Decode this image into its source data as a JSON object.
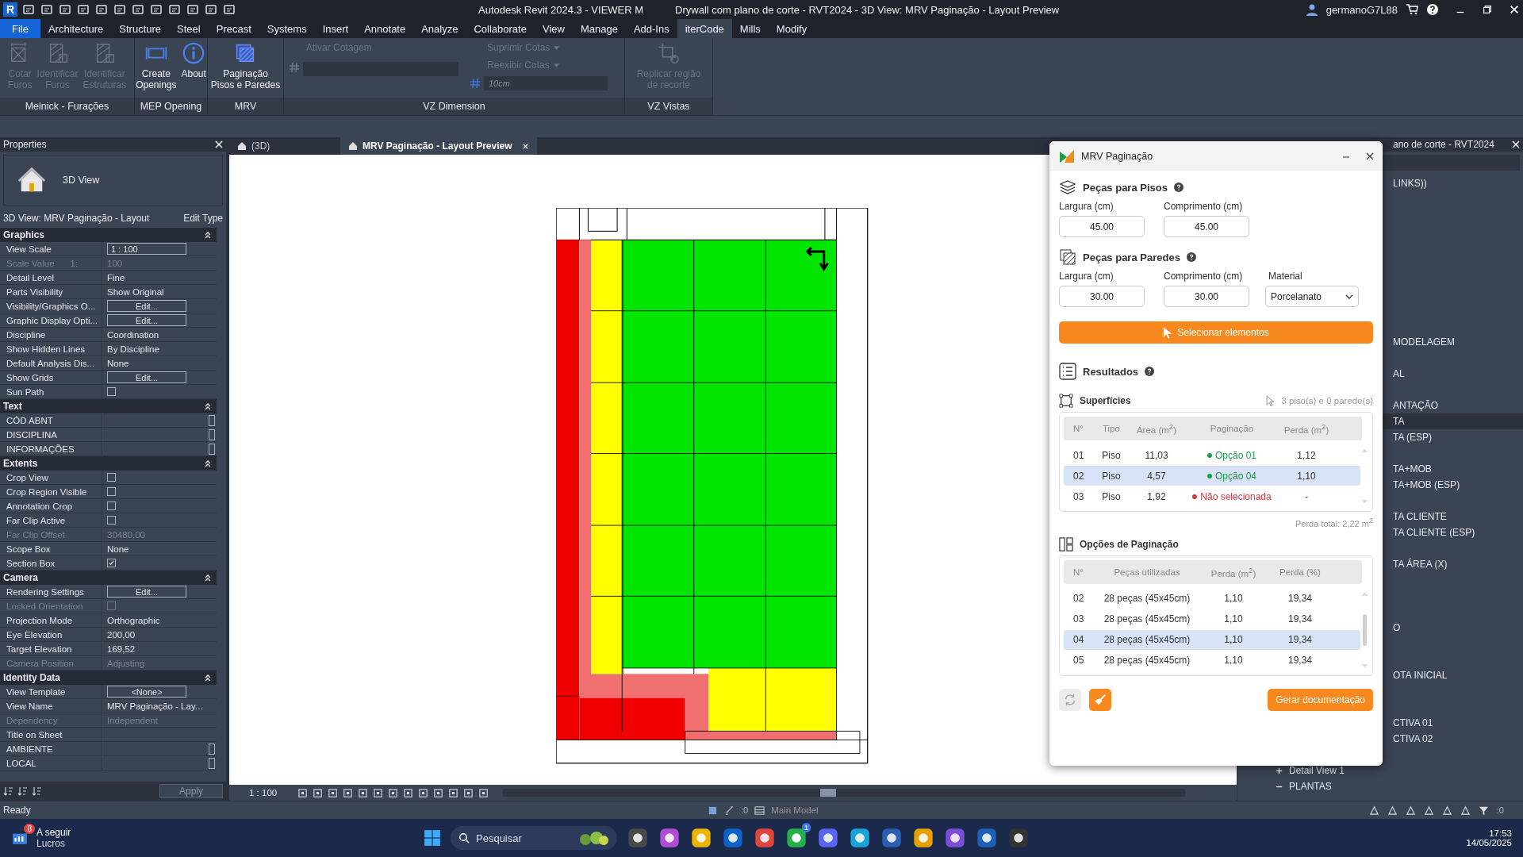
{
  "title_bar": {
    "app_logo": "R",
    "app_title": "Autodesk Revit 2024.3 - VIEWER M",
    "document_title": "Drywall com plano de corte - RVT2024 - 3D View: MRV Paginação - Layout Preview",
    "user": "germanoG7L88"
  },
  "menu_tabs": [
    {
      "label": "File",
      "kind": "file",
      "selected": false
    },
    {
      "label": "Architecture",
      "kind": "tab",
      "selected": false
    },
    {
      "label": "Structure",
      "kind": "tab",
      "selected": false
    },
    {
      "label": "Steel",
      "kind": "tab",
      "selected": false
    },
    {
      "label": "Precast",
      "kind": "tab",
      "selected": false
    },
    {
      "label": "Systems",
      "kind": "tab",
      "selected": false
    },
    {
      "label": "Insert",
      "kind": "tab",
      "selected": false
    },
    {
      "label": "Annotate",
      "kind": "tab",
      "selected": false
    },
    {
      "label": "Analyze",
      "kind": "tab",
      "selected": false
    },
    {
      "label": "Collaborate",
      "kind": "tab",
      "selected": false
    },
    {
      "label": "View",
      "kind": "tab",
      "selected": false
    },
    {
      "label": "Manage",
      "kind": "tab",
      "selected": false
    },
    {
      "label": "Add-Ins",
      "kind": "tab",
      "selected": false
    },
    {
      "label": "iterCode",
      "kind": "tab",
      "selected": true
    },
    {
      "label": "Mills",
      "kind": "tab",
      "selected": false
    },
    {
      "label": "Modify",
      "kind": "tab",
      "selected": false
    }
  ],
  "ribbon": {
    "panels": [
      {
        "title": "Melnick - Furações",
        "kind": "large",
        "buttons": [
          {
            "lines": [
              "Cotar",
              "Furos"
            ],
            "kind": "hole",
            "disabled": true
          },
          {
            "lines": [
              "Identificar",
              "Furos"
            ],
            "kind": "identify",
            "disabled": true
          },
          {
            "lines": [
              "Identificar",
              "Estruturas"
            ],
            "kind": "identify",
            "disabled": true
          }
        ]
      },
      {
        "title": "MEP Opening",
        "kind": "large",
        "buttons": [
          {
            "lines": [
              "Create",
              "Openings"
            ],
            "kind": "openings",
            "disabled": false
          },
          {
            "lines": [
              "About"
            ],
            "kind": "about",
            "disabled": false
          }
        ]
      },
      {
        "title": "MRV",
        "kind": "large",
        "buttons": [
          {
            "lines": [
              "Paginação",
              "Pisos e Paredes"
            ],
            "kind": "tiles",
            "disabled": false
          }
        ]
      },
      {
        "title": "VZ Dimension",
        "kind": "controls",
        "items": [
          {
            "label": "Ativar Cotagem",
            "disabled": true
          },
          {
            "label": "Suprimir Cotas",
            "disabled": true
          },
          {
            "label": "Reexibir Cotas",
            "disabled": true
          }
        ],
        "field_value": "10cm"
      },
      {
        "title": "VZ Vistas",
        "kind": "large",
        "buttons": [
          {
            "lines": [
              "Replicar região",
              "de recorte"
            ],
            "kind": "replicate",
            "disabled": true
          }
        ]
      }
    ]
  },
  "properties": {
    "title": "Properties",
    "type_name": "3D View",
    "instance": "3D View: MRV Paginação - Layout",
    "edit_type": "Edit Type",
    "apply": "Apply",
    "sections": [
      {
        "title": "Graphics",
        "rows": [
          {
            "label": "View Scale",
            "kind": "input",
            "value": "1 : 100",
            "disabled": false
          },
          {
            "label": "Scale Value",
            "suffix": "1:",
            "kind": "text",
            "value": "100",
            "disabled": true
          },
          {
            "label": "Detail Level",
            "kind": "text",
            "value": "Fine",
            "disabled": false
          },
          {
            "label": "Parts Visibility",
            "kind": "text",
            "value": "Show Original",
            "disabled": false
          },
          {
            "label": "Visibility/Graphics O...",
            "kind": "button",
            "value": "Edit...",
            "disabled": false
          },
          {
            "label": "Graphic Display Opti...",
            "kind": "button",
            "value": "Edit...",
            "disabled": false
          },
          {
            "label": "Discipline",
            "kind": "text",
            "value": "Coordination",
            "disabled": false
          },
          {
            "label": "Show Hidden Lines",
            "kind": "text",
            "value": "By Discipline",
            "disabled": false
          },
          {
            "label": "Default Analysis Dis...",
            "kind": "text",
            "value": "None",
            "disabled": false
          },
          {
            "label": "Show Grids",
            "kind": "button",
            "value": "Edit...",
            "disabled": false
          },
          {
            "label": "Sun Path",
            "kind": "checkbox",
            "checked": false,
            "disabled": false
          }
        ]
      },
      {
        "title": "Text",
        "rows": [
          {
            "label": "CÓD ABNT",
            "kind": "field",
            "disabled": false
          },
          {
            "label": "DISCIPLINA",
            "kind": "field",
            "disabled": false
          },
          {
            "label": "INFORMAÇÕES",
            "kind": "field",
            "disabled": false
          }
        ]
      },
      {
        "title": "Extents",
        "rows": [
          {
            "label": "Crop View",
            "kind": "checkbox",
            "checked": false,
            "disabled": false
          },
          {
            "label": "Crop Region Visible",
            "kind": "checkbox",
            "checked": false,
            "disabled": false
          },
          {
            "label": "Annotation Crop",
            "kind": "checkbox",
            "checked": false,
            "disabled": false
          },
          {
            "label": "Far Clip Active",
            "kind": "checkbox",
            "checked": false,
            "disabled": false
          },
          {
            "label": "Far Clip Offset",
            "kind": "text",
            "value": "30480,00",
            "disabled": true
          },
          {
            "label": "Scope Box",
            "kind": "text",
            "value": "None",
            "disabled": false
          },
          {
            "label": "Section Box",
            "kind": "checkbox",
            "checked": true,
            "disabled": false
          }
        ]
      },
      {
        "title": "Camera",
        "rows": [
          {
            "label": "Rendering Settings",
            "kind": "button",
            "value": "Edit...",
            "disabled": false
          },
          {
            "label": "Locked Orientation",
            "kind": "checkbox",
            "checked": false,
            "disabled": true
          },
          {
            "label": "Projection Mode",
            "kind": "text",
            "value": "Orthographic",
            "disabled": false
          },
          {
            "label": "Eye Elevation",
            "kind": "text",
            "value": "200,00",
            "disabled": false
          },
          {
            "label": "Target Elevation",
            "kind": "text",
            "value": "169,52",
            "disabled": false
          },
          {
            "label": "Camera Position",
            "kind": "text",
            "value": "Adjusting",
            "disabled": true
          }
        ]
      },
      {
        "title": "Identity Data",
        "rows": [
          {
            "label": "View Template",
            "kind": "button",
            "value": "<None>",
            "disabled": false
          },
          {
            "label": "View Name",
            "kind": "text",
            "value": "MRV Paginação - Lay...",
            "disabled": false
          },
          {
            "label": "Dependency",
            "kind": "text",
            "value": "Independent",
            "disabled": true
          },
          {
            "label": "Title on Sheet",
            "kind": "text",
            "value": "",
            "disabled": false
          },
          {
            "label": "AMBIENTE",
            "kind": "field",
            "disabled": false
          },
          {
            "label": "LOCAL",
            "kind": "field",
            "disabled": false
          }
        ]
      }
    ]
  },
  "view_tabs": [
    {
      "label": "(3D)",
      "selected": false,
      "closable": false
    },
    {
      "label": "MRV Paginação - Layout Preview",
      "selected": true,
      "closable": true
    }
  ],
  "view_bar": {
    "scale": "1 : 100"
  },
  "dialog": {
    "title": "MRV Paginação",
    "floors": {
      "heading": "Peças para Pisos",
      "fields": [
        {
          "label": "Largura (cm)",
          "value": "45.00"
        },
        {
          "label": "Comprimento (cm)",
          "value": "45.00"
        }
      ]
    },
    "walls": {
      "heading": "Peças para Paredes",
      "fields": [
        {
          "label": "Largura (cm)",
          "value": "30.00"
        },
        {
          "label": "Comprimento (cm)",
          "value": "30.00"
        }
      ],
      "material": {
        "label": "Material",
        "value": "Porcelanato"
      }
    },
    "select_button": "Selecionar elementos",
    "results_heading": "Resultados",
    "surfaces": {
      "heading": "Superfícies",
      "summary": "3 piso(s) e 0 parede(s)",
      "columns": [
        "N°",
        "Tipo",
        "Área (m$^{2}$)",
        "Paginação",
        "Perda (m$^{2}$)"
      ],
      "rows": [
        {
          "n": "01",
          "tipo": "Piso",
          "area": "11,03",
          "paginacao": {
            "text": "Opção 01",
            "color": "#1f9d4a"
          },
          "perda": "1,12",
          "selected": false
        },
        {
          "n": "02",
          "tipo": "Piso",
          "area": "4,57",
          "paginacao": {
            "text": "Opção 04",
            "color": "#1f9d4a"
          },
          "perda": "1,10",
          "selected": true
        },
        {
          "n": "03",
          "tipo": "Piso",
          "area": "1,92",
          "paginacao": {
            "text": "Não selecionada",
            "color": "#d9363e"
          },
          "perda": "-",
          "selected": false
        }
      ],
      "total": "Perda total: 2,22 m$^{2}$"
    },
    "options": {
      "heading": "Opções de Paginação",
      "columns": [
        "N°",
        "Peças utilizadas",
        "Perda (m$^{2}$)",
        "Perda (%)"
      ],
      "rows": [
        {
          "cells": [
            "02",
            "28 peças (45x45cm)",
            "1,10",
            "19,34"
          ],
          "selected": false
        },
        {
          "cells": [
            "03",
            "28 peças (45x45cm)",
            "1,10",
            "19,34"
          ],
          "selected": false
        },
        {
          "cells": [
            "04",
            "28 peças (45x45cm)",
            "1,10",
            "19,34"
          ],
          "selected": true
        },
        {
          "cells": [
            "05",
            "28 peças (45x45cm)",
            "1,10",
            "19,34"
          ],
          "selected": false
        }
      ]
    },
    "generate_button": "Gerar documentação"
  },
  "browser": {
    "title": "ano de corte - RVT2024",
    "items": [
      {
        "label": "LINKS))",
        "selected": false
      },
      {
        "label": "MODELAGEM",
        "selected": false
      },
      {
        "label": "AL",
        "selected": false
      },
      {
        "label": "ANTAÇÃO",
        "selected": false
      },
      {
        "label": "TA",
        "selected": true
      },
      {
        "label": "TA (ESP)",
        "selected": false
      },
      {
        "label": "TA+MOB",
        "selected": false
      },
      {
        "label": "TA+MOB (ESP)",
        "selected": false
      },
      {
        "label": "TA CLIENTE",
        "selected": false
      },
      {
        "label": "TA CLIENTE (ESP)",
        "selected": false
      },
      {
        "label": "TA ÁREA (X)",
        "selected": false
      },
      {
        "label": "O",
        "selected": false
      },
      {
        "label": "OTA INICIAL",
        "selected": false
      },
      {
        "label": "CTIVA 01",
        "selected": false
      },
      {
        "label": "CTIVA 02",
        "selected": false
      }
    ],
    "tree": [
      {
        "label": "Detail View 1",
        "expanded": false
      },
      {
        "label": "PLANTAS",
        "expanded": true
      }
    ]
  },
  "status_bar": {
    "text": "Ready",
    "count": ":0",
    "model": "Main Model",
    "filter_count": ":0"
  },
  "taskbar": {
    "weather": {
      "badge": "8",
      "line1": "A seguir",
      "line2": "Lucros"
    },
    "search": "Pesquisar",
    "chat_badge": "1",
    "time": "17:53",
    "date": "14/05/2025"
  }
}
